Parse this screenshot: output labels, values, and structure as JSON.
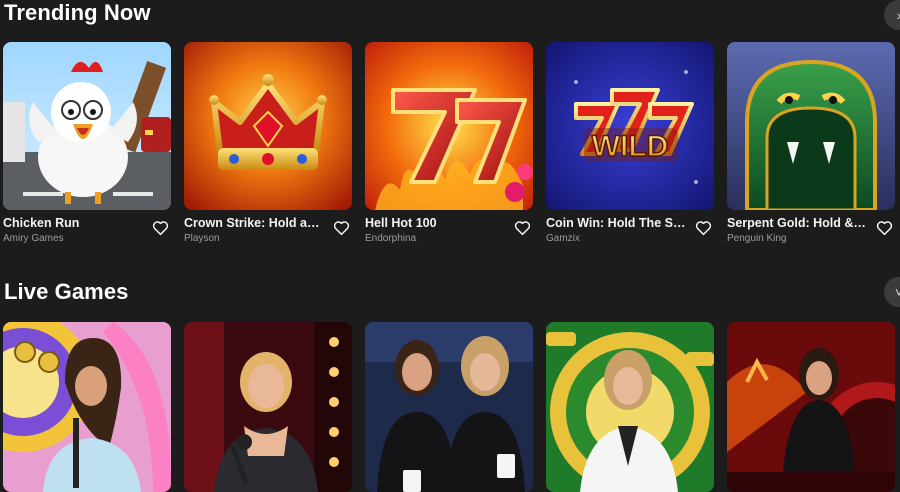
{
  "trending": {
    "title": "Trending Now",
    "games": [
      {
        "name": "Chicken Run",
        "provider": "Amiry Games",
        "art": "chicken-art"
      },
      {
        "name": "Crown Strike: Hold and ...",
        "provider": "Playson",
        "art": "crown-art"
      },
      {
        "name": "Hell Hot 100",
        "provider": "Endorphina",
        "art": "seven-art"
      },
      {
        "name": "Coin Win: Hold The Spin",
        "provider": "Gamzix",
        "art": "wild-art"
      },
      {
        "name": "Serpent Gold: Hold & Win",
        "provider": "Penguin King",
        "art": "snake-art"
      }
    ]
  },
  "live": {
    "title": "Live Games",
    "games": [
      {
        "art": "wheel-dealer-art"
      },
      {
        "art": "dealer-microphone-art"
      },
      {
        "art": "two-dealers-art"
      },
      {
        "art": "green-wheel-dealer-art"
      },
      {
        "art": "roulette-dealer-art"
      }
    ]
  },
  "icons": {
    "favorite": "heart-outline-icon",
    "scroll": "chevron-icon"
  }
}
